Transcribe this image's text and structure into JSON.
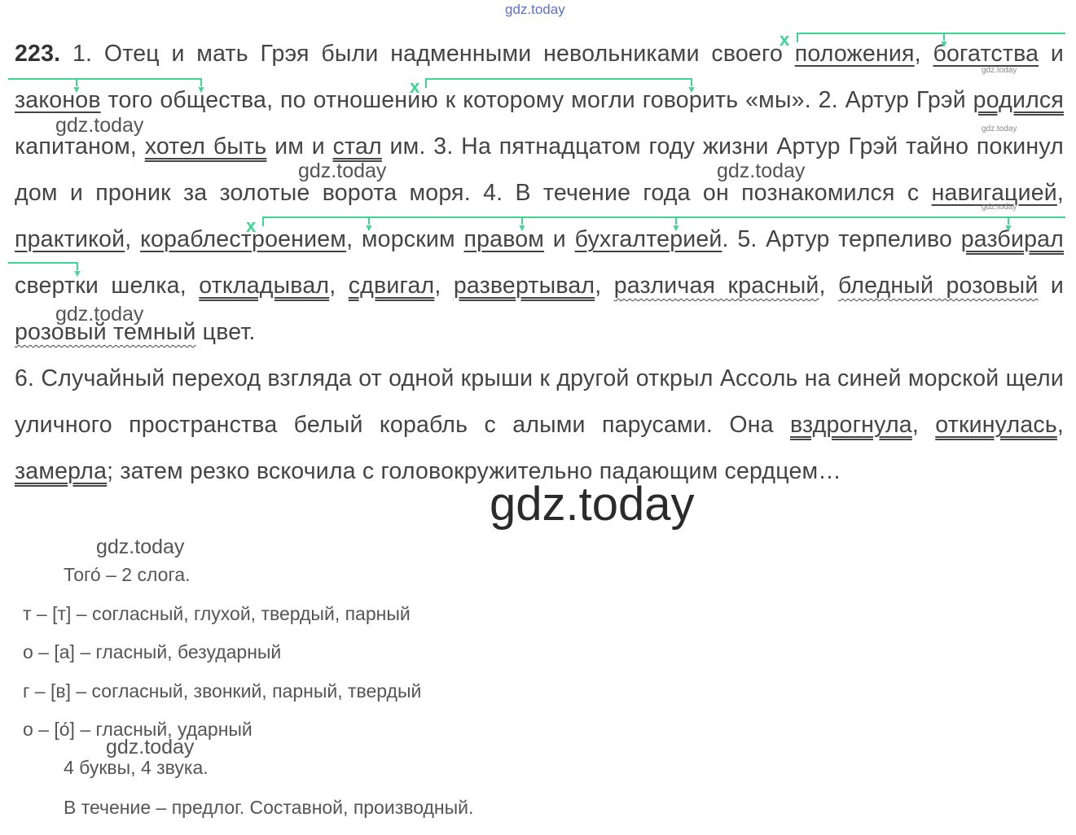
{
  "watermarks": {
    "text": "gdz.today"
  },
  "exercise": {
    "number": "223.",
    "s1": {
      "n": "1.",
      "a": "Отец и мать Грэя были надменными невольниками своего ",
      "w1": "положения",
      "c1": ", ",
      "w2": "богатства",
      "c2": " и ",
      "w3": "законов",
      "b": " того общества, по отношению к которому могли говорить «мы». "
    },
    "s2": {
      "n": "2.",
      "a": " Артур Грэй ",
      "v1": "родился",
      "b": " капитаном, ",
      "v2": "хотел быть",
      "c": " им и ",
      "v3": "стал",
      "d": " им. "
    },
    "s3": {
      "text": "3. На пятнадцатом году жизни Артур Грэй тайно покинул дом и проник за золотые ворота моря. "
    },
    "s4": {
      "a": "4. В течение года он познакомился с ",
      "w1": "навигацией",
      "c1": ", ",
      "w2": "практикой",
      "c2": ", ",
      "w3": "кораблестроением",
      "c3": ", морским ",
      "w4": "правом",
      "c4": " и ",
      "w5": "бухгалтерией",
      "e": ". "
    },
    "s5": {
      "a": "5. Артур терпеливо ",
      "v1": "разбирал",
      "b": " свертки шелка, ",
      "v2": "откладывал",
      "c1": ", ",
      "v3": "сдвигал",
      "c2": ", ",
      "v4": "развертывал",
      "c3": ", ",
      "p1": "различая красный",
      "c4": ", ",
      "p2": "бледный розовый",
      "c5": " и ",
      "p3": "розовый темный",
      "e": " цвет."
    },
    "s6": {
      "a": "6. Случайный переход взгляда от одной крыши к другой открыл Ассоль на синей морской щели уличного пространства белый корабль с алыми парусами. Она ",
      "v1": "вздрогнула",
      "c1": ", ",
      "v2": "откинулась",
      "c2": ", ",
      "v3": "замерла",
      "e": "; затем резко вскочила с головокружительно падающим сердцем…"
    },
    "mark": "x"
  },
  "analysis": {
    "title": "Того́ – 2 слога.",
    "rows": [
      "т – [т] – согласный, глухой, твердый, парный",
      "о – [а] – гласный, безударный",
      "г – [в] – согласный, звонкий, парный, твердый",
      "о – [о́] – гласный, ударный"
    ],
    "summary": "4 буквы, 4 звука.",
    "note": "В течение – предлог. Составной, производный."
  }
}
